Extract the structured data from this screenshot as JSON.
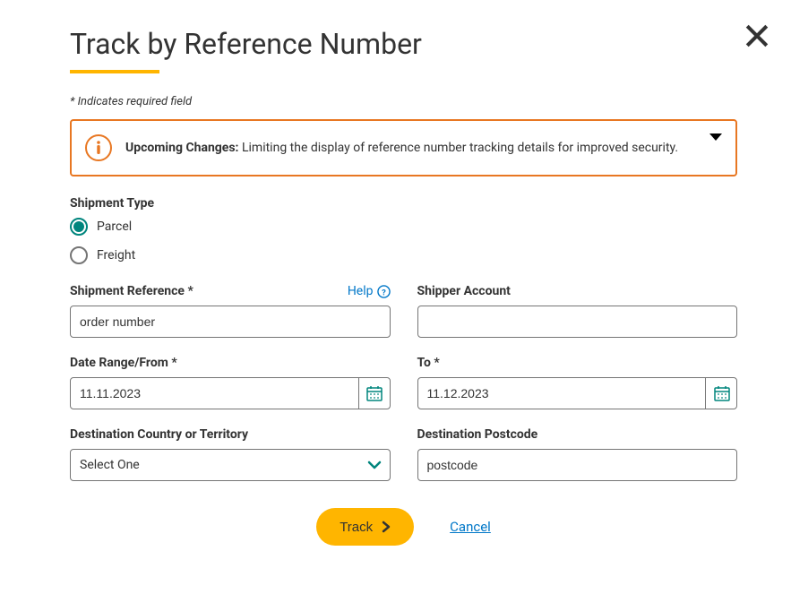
{
  "title": "Track by Reference Number",
  "required_note": "* Indicates required field",
  "banner": {
    "bold_text": "Upcoming Changes:",
    "rest_text": " Limiting the display of reference number tracking details for improved security."
  },
  "shipment_type": {
    "label": "Shipment Type",
    "options": {
      "parcel": "Parcel",
      "freight": "Freight"
    }
  },
  "reference": {
    "label": "Shipment Reference *",
    "help": "Help",
    "value": "order number"
  },
  "shipper_account": {
    "label": "Shipper Account",
    "value": ""
  },
  "date_from": {
    "label": "Date Range/From *",
    "value": "11.11.2023"
  },
  "date_to": {
    "label": "To *",
    "value": "11.12.2023"
  },
  "country": {
    "label": "Destination Country or Territory",
    "selected": "Select One"
  },
  "postcode": {
    "label": "Destination Postcode",
    "value": "postcode"
  },
  "actions": {
    "track": "Track",
    "cancel": "Cancel"
  }
}
